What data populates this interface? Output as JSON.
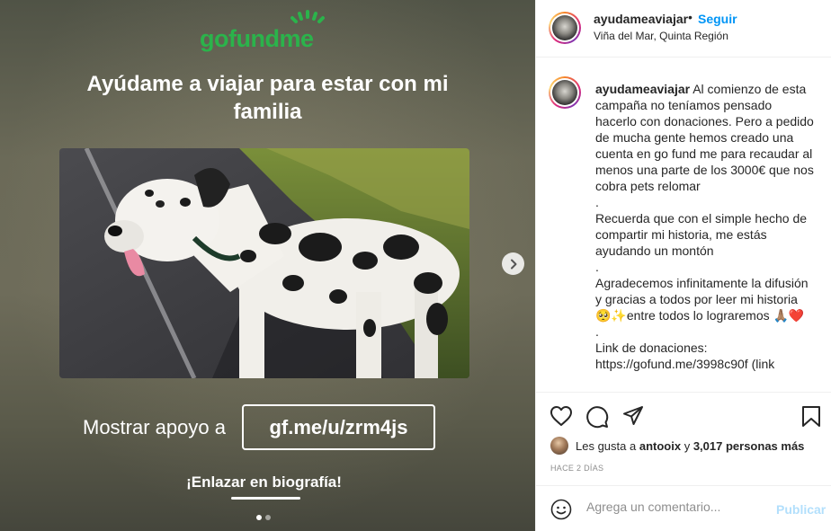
{
  "media": {
    "brand": "gofundme",
    "headline": "Ayúdame a viajar para estar con mi familia",
    "support_label": "Mostrar apoyo a",
    "link": "gf.me/u/zrm4js",
    "bio_text": "¡Enlazar en biografía!",
    "brand_color": "#2bb34b"
  },
  "post": {
    "username": "ayudameaviajar",
    "separator": "•",
    "follow_label": "Seguir",
    "location": "Viña del Mar, Quinta Región",
    "caption": "Al comienzo de esta campaña no teníamos pensado hacerlo con donaciones. Pero a pedido de mucha gente hemos creado una cuenta en go fund me para recaudar al menos una parte de los 3000€ que nos cobra pets relomar\n.\nRecuerda que con el simple hecho de compartir mi historia, me estás ayudando un montón\n.\nAgradecemos infinitamente la difusión y gracias a todos por leer mi historia 🥺✨entre todos lo lograremos 🙏🏽❤️\n.\nLink de donaciones:\nhttps://gofund.me/3998c90f (link",
    "likes_prefix": "Les gusta a",
    "likes_user": "antooix",
    "likes_mid": "y",
    "likes_count": "3,017 personas más",
    "time": "HACE 2 DÍAS",
    "comment_placeholder": "Agrega un comentario...",
    "publish_label": "Publicar",
    "accent_color": "#0095f6"
  },
  "icons": [
    "heart-icon",
    "comment-icon",
    "share-icon",
    "bookmark-icon",
    "emoji-icon",
    "chevron-right-icon"
  ]
}
